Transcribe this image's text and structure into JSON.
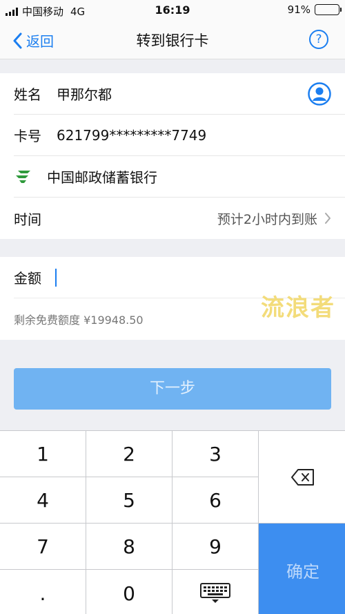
{
  "status": {
    "carrier": "中国移动",
    "network": "4G",
    "time": "16:19",
    "battery": "91%",
    "battery_level": 0.91
  },
  "nav": {
    "back_label": "返回",
    "title": "转到银行卡",
    "help_label": "?"
  },
  "recipient": {
    "name_label": "姓名",
    "name_value": "甲那尔都",
    "card_label": "卡号",
    "card_value": "621799*********7749",
    "bank_name": "中国邮政储蓄银行",
    "time_label": "时间",
    "time_value": "预计2小时内到账"
  },
  "amount": {
    "label": "金额",
    "value": "",
    "quota": "剩余免费额度 ¥19948.50"
  },
  "watermark": "流浪者",
  "next_button": "下一步",
  "keypad": {
    "keys": [
      "1",
      "2",
      "3",
      "4",
      "5",
      "6",
      "7",
      "8",
      "9",
      ".",
      "0"
    ],
    "confirm": "确定"
  },
  "colors": {
    "accent": "#1b7ef0",
    "next_disabled": "#70b3f2",
    "confirm": "#3d8ef0",
    "bank_logo": "#2f9a3c"
  }
}
